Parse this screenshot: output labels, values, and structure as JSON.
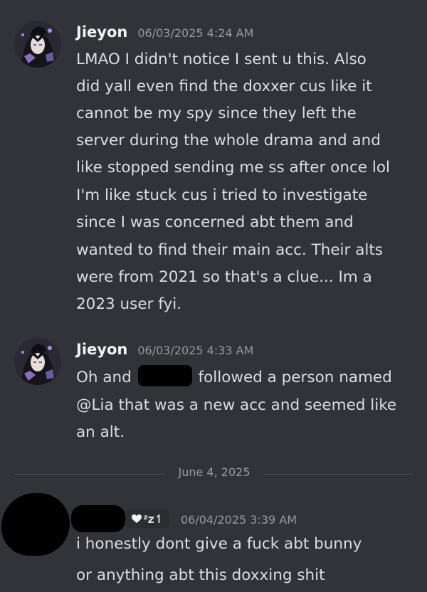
{
  "messages": [
    {
      "username": "Jieyon",
      "timestamp": "06/03/2025 4:24 AM",
      "lines": [
        "LMAO I didn't notice I sent u  this. Also",
        "did yall even find the doxxer cus like it",
        "cannot be my spy since they left the",
        "server during the whole drama and and",
        "like stopped sending me ss after once lol",
        "I'm like stuck cus i tried to investigate",
        "since I was concerned abt them and",
        "wanted to find their main acc. Their alts",
        "were from 2021 so that's a clue... Im a",
        "2023 user fyi."
      ]
    },
    {
      "username": "Jieyon",
      "timestamp": "06/03/2025 4:33 AM",
      "line1_before_redaction": "Oh and",
      "line1_after_redaction": "followed a person named",
      "lines": [
        "@Lia that was a new acc and seemed like",
        "an alt."
      ]
    },
    {
      "timestamp": "06/04/2025 3:39 AM",
      "status_icons": [
        "heart-icon",
        "sleep-zz-icon"
      ],
      "lines": [
        "i honestly dont give a fuck abt bunny",
        "or anything abt this doxxing shit"
      ]
    }
  ],
  "date_divider": "June 4, 2025",
  "colors": {
    "background": "#313338",
    "text": "#dbdee1",
    "username": "#f2f3f5",
    "muted": "#949ba4",
    "divider": "#4e5058"
  }
}
